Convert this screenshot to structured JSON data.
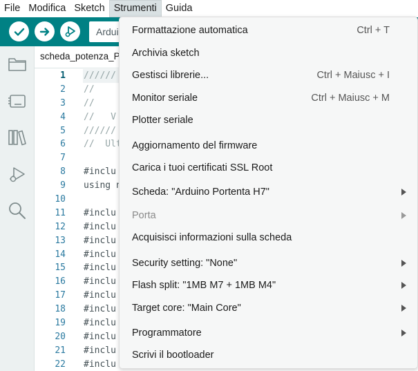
{
  "menubar": {
    "items": [
      {
        "label": "File"
      },
      {
        "label": "Modifica"
      },
      {
        "label": "Sketch"
      },
      {
        "label": "Strumenti"
      },
      {
        "label": "Guida"
      }
    ]
  },
  "toolbar": {
    "board_select": "Ardui",
    "verify_icon": "checkmark-icon",
    "upload_icon": "arrow-right-icon",
    "debug_icon": "debug-icon"
  },
  "sidebar": {
    "icons": [
      "folder-icon",
      "board-icon",
      "library-icon",
      "debug-icon",
      "search-icon"
    ]
  },
  "editor": {
    "tab_label": "scheda_potenza_P",
    "lines": [
      {
        "n": "1",
        "text": "//////",
        "kind": "comment"
      },
      {
        "n": "2",
        "text": "//",
        "kind": "comment"
      },
      {
        "n": "3",
        "text": "//",
        "kind": "comment"
      },
      {
        "n": "4",
        "text": "//   V",
        "kind": "comment"
      },
      {
        "n": "5",
        "text": "//////",
        "kind": "comment"
      },
      {
        "n": "6",
        "text": "//  Ult",
        "kind": "comment"
      },
      {
        "n": "7",
        "text": "",
        "kind": "comment"
      },
      {
        "n": "8",
        "text": "#inclu",
        "kind": "kw"
      },
      {
        "n": "9",
        "text": "using n",
        "kind": "kw"
      },
      {
        "n": "10",
        "text": "",
        "kind": "comment"
      },
      {
        "n": "11",
        "text": "#inclu",
        "kind": "kw"
      },
      {
        "n": "12",
        "text": "#inclu",
        "kind": "kw"
      },
      {
        "n": "13",
        "text": "#inclu",
        "kind": "kw"
      },
      {
        "n": "14",
        "text": "#inclu",
        "kind": "kw"
      },
      {
        "n": "15",
        "text": "#inclu",
        "kind": "kw"
      },
      {
        "n": "16",
        "text": "#inclu",
        "kind": "kw"
      },
      {
        "n": "17",
        "text": "#inclu",
        "kind": "kw"
      },
      {
        "n": "18",
        "text": "#inclu",
        "kind": "kw"
      },
      {
        "n": "19",
        "text": "#inclu",
        "kind": "kw"
      },
      {
        "n": "20",
        "text": "#inclu",
        "kind": "kw"
      },
      {
        "n": "21",
        "text": "#inclu",
        "kind": "kw"
      },
      {
        "n": "22",
        "text": "#inclu",
        "kind": "kw"
      }
    ]
  },
  "dropdown": {
    "items": [
      {
        "label": "Formattazione automatica",
        "shortcut": "Ctrl + T",
        "submenu": false,
        "disabled": false
      },
      {
        "label": "Archivia sketch",
        "shortcut": "",
        "submenu": false,
        "disabled": false
      },
      {
        "label": "Gestisci librerie...",
        "shortcut": "Ctrl + Maiusc + I",
        "submenu": false,
        "disabled": false
      },
      {
        "label": "Monitor seriale",
        "shortcut": "Ctrl + Maiusc + M",
        "submenu": false,
        "disabled": false
      },
      {
        "label": "Plotter seriale",
        "shortcut": "",
        "submenu": false,
        "disabled": false
      },
      {
        "label": "Aggiornamento del firmware",
        "shortcut": "",
        "submenu": false,
        "disabled": false
      },
      {
        "label": "Carica i tuoi certificati SSL Root",
        "shortcut": "",
        "submenu": false,
        "disabled": false
      },
      {
        "label": "Scheda: \"Arduino Portenta H7\"",
        "shortcut": "",
        "submenu": true,
        "disabled": false
      },
      {
        "label": "Porta",
        "shortcut": "",
        "submenu": true,
        "disabled": true
      },
      {
        "label": "Acquisisci informazioni sulla scheda",
        "shortcut": "",
        "submenu": false,
        "disabled": false
      },
      {
        "label": "Security setting: \"None\"",
        "shortcut": "",
        "submenu": true,
        "disabled": false
      },
      {
        "label": "Flash split: \"1MB M7 + 1MB M4\"",
        "shortcut": "",
        "submenu": true,
        "disabled": false
      },
      {
        "label": "Target core: \"Main Core\"",
        "shortcut": "",
        "submenu": true,
        "disabled": false
      },
      {
        "label": "Programmatore",
        "shortcut": "",
        "submenu": true,
        "disabled": false
      },
      {
        "label": "Scrivi il bootloader",
        "shortcut": "",
        "submenu": false,
        "disabled": false
      }
    ]
  },
  "colors": {
    "toolbar_teal": "#008184",
    "sidebar_bg": "#ecf1f1",
    "menu_bg": "#f6f7f7"
  }
}
